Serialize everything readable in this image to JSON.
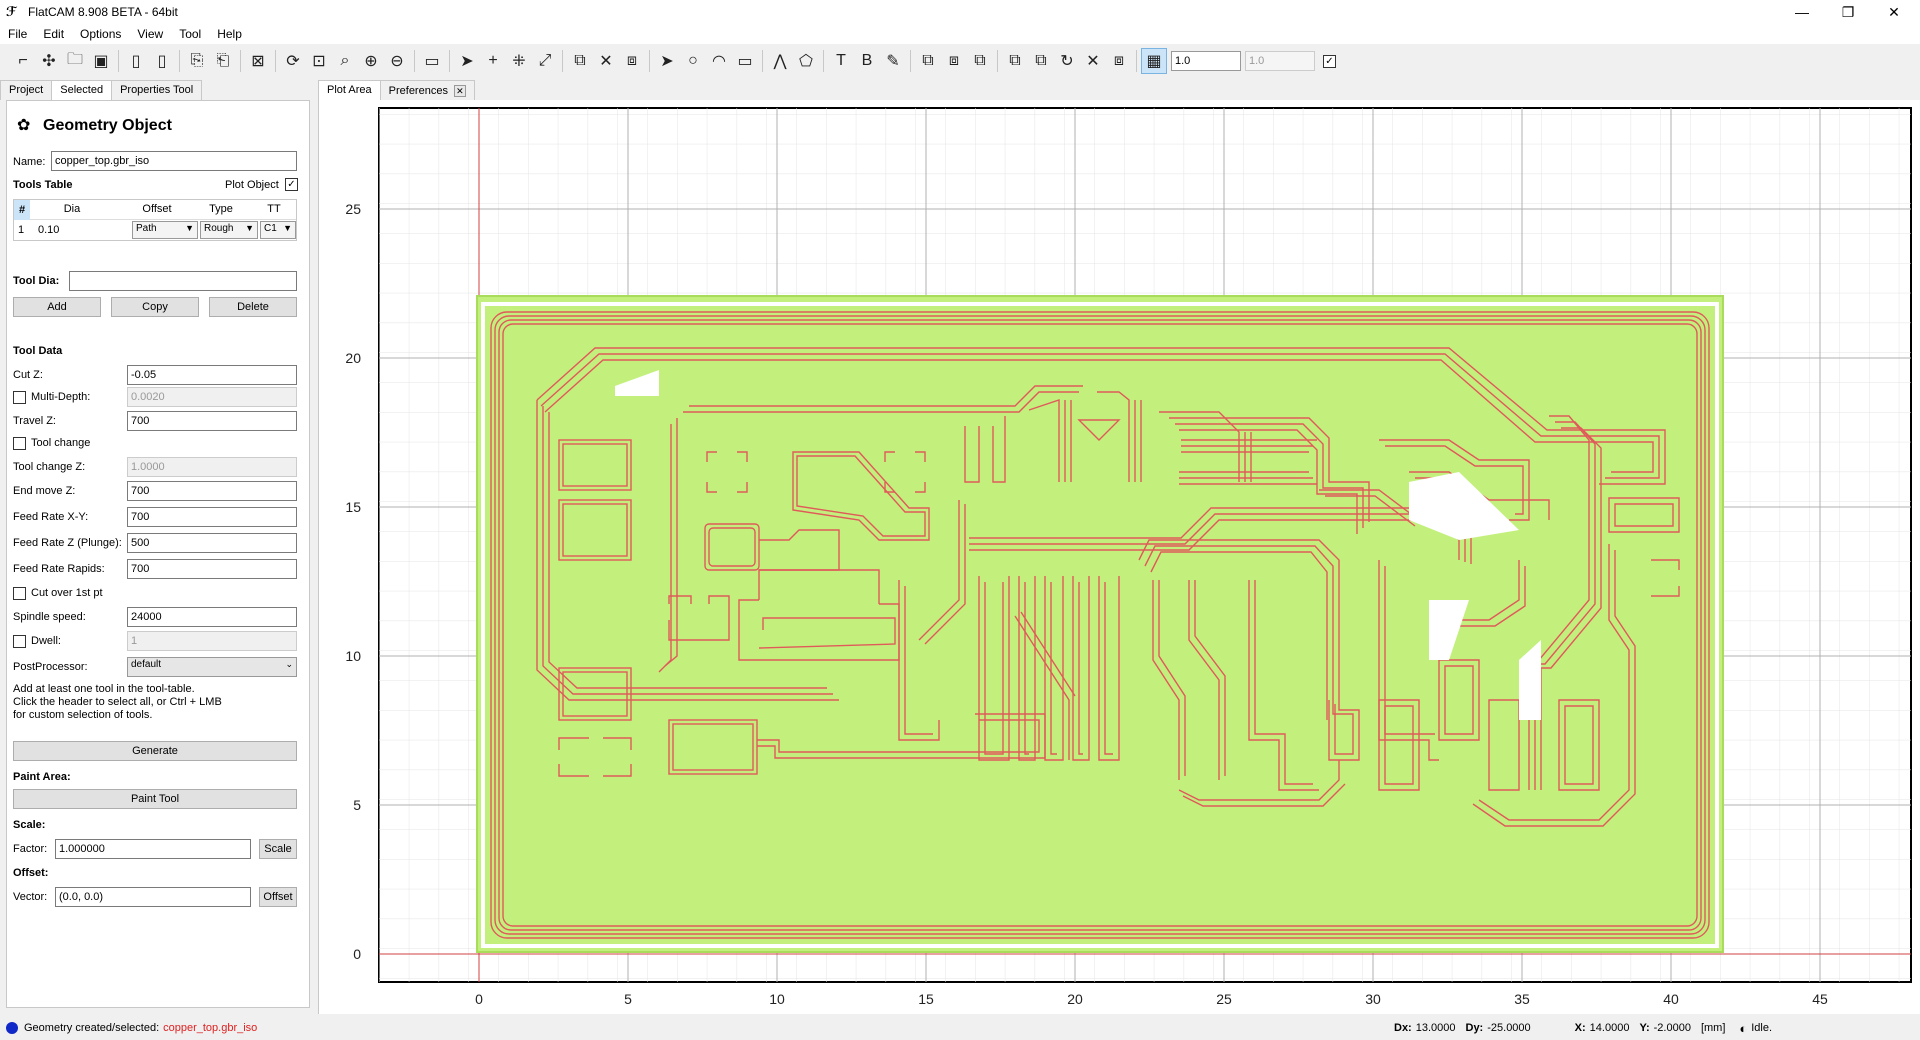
{
  "window": {
    "title": "FlatCAM 8.908 BETA - 64bit",
    "controls": [
      "—",
      "❐",
      "✕"
    ]
  },
  "menu": [
    "File",
    "Edit",
    "Options",
    "View",
    "Tool",
    "Help"
  ],
  "toolbar": {
    "grid_x": "1.0",
    "grid_y": "1.0"
  },
  "left_tabs": [
    "Project",
    "Selected",
    "Properties Tool"
  ],
  "panel": {
    "title": "Geometry Object",
    "name_label": "Name:",
    "name_value": "copper_top.gbr_iso",
    "tools_table_label": "Tools Table",
    "plot_object_label": "Plot Object",
    "plot_object_checked": true,
    "table_headers": [
      "#",
      "Dia",
      "Offset",
      "Type",
      "TT"
    ],
    "table_rows": [
      {
        "num": "1",
        "dia": "0.10",
        "offset": "Path",
        "type": "Rough",
        "tt": "C1"
      }
    ],
    "tool_dia_label": "Tool Dia:",
    "add": "Add",
    "copy": "Copy",
    "delete": "Delete",
    "tool_data_label": "Tool Data",
    "cut_z_label": "Cut Z:",
    "cut_z": "-0.05",
    "multi_depth_label": "Multi-Depth:",
    "multi_depth": "0.0020",
    "travel_z_label": "Travel Z:",
    "travel_z": "700",
    "tool_change_label": "Tool change",
    "tool_change_z_label": "Tool change Z:",
    "tool_change_z": "1.0000",
    "end_move_z_label": "End move Z:",
    "end_move_z": "700",
    "feed_xy_label": "Feed Rate X-Y:",
    "feed_xy": "700",
    "feed_z_label": "Feed Rate Z (Plunge):",
    "feed_z": "500",
    "feed_rapids_label": "Feed Rate Rapids:",
    "feed_rapids": "700",
    "cut_over_label": "Cut over 1st pt",
    "spindle_label": "Spindle speed:",
    "spindle": "24000",
    "dwell_label": "Dwell:",
    "dwell": "1",
    "postproc_label": "PostProcessor:",
    "postproc": "default",
    "hint": [
      "Add at least one tool in the tool-table.",
      "Click the header to select all, or Ctrl + LMB",
      "for custom selection of tools."
    ],
    "generate": "Generate",
    "paint_area_label": "Paint Area:",
    "paint_tool": "Paint Tool",
    "scale_label": "Scale:",
    "factor_label": "Factor:",
    "factor": "1.000000",
    "scale_btn": "Scale",
    "offset_label": "Offset:",
    "vector_label": "Vector:",
    "vector": "(0.0, 0.0)",
    "offset_btn": "Offset"
  },
  "right_tabs": [
    "Plot Area",
    "Preferences"
  ],
  "plot": {
    "x_ticks": [
      "0",
      "5",
      "10",
      "15",
      "20",
      "25",
      "30",
      "35",
      "40",
      "45"
    ],
    "y_ticks": [
      "0",
      "5",
      "10",
      "15",
      "20",
      "25"
    ],
    "board_fill": "#c3f07d",
    "trace_color": "#e05a5a"
  },
  "status": {
    "message_prefix": "Geometry created/selected:",
    "message_object": "copper_top.gbr_iso",
    "dx_label": "Dx:",
    "dx": "13.0000",
    "dy_label": "Dy:",
    "dy": "-25.0000",
    "x_label": "X:",
    "x": "14.0000",
    "y_label": "Y:",
    "y": "-2.0000",
    "units": "[mm]",
    "state": "Idle."
  }
}
